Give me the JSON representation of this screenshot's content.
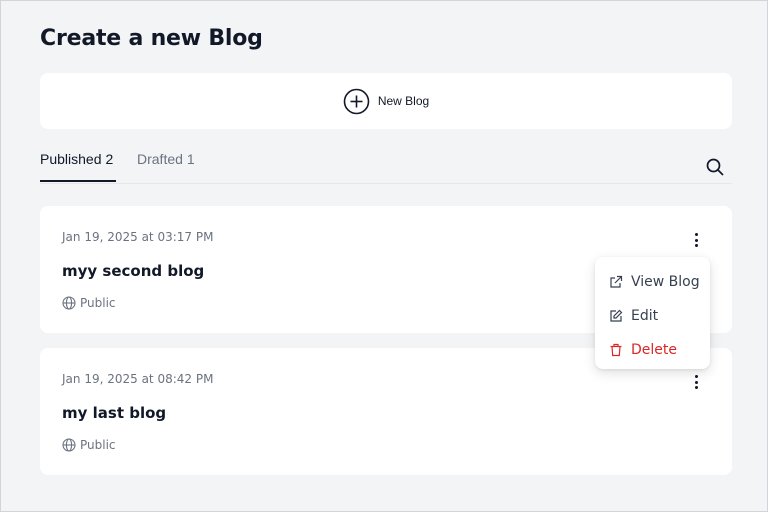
{
  "page": {
    "title": "Create a new Blog"
  },
  "new_blog": {
    "label": "New Blog"
  },
  "tabs": [
    {
      "label": "Published",
      "count": "2",
      "active": true
    },
    {
      "label": "Drafted",
      "count": "1",
      "active": false
    }
  ],
  "blogs": [
    {
      "date": "Jan 19, 2025 at 03:17 PM",
      "title": "myy second blog",
      "visibility": "Public"
    },
    {
      "date": "Jan 19, 2025 at 08:42 PM",
      "title": "my last blog",
      "visibility": "Public"
    }
  ],
  "menu": {
    "items": [
      {
        "label": "View Blog",
        "icon": "external-link-icon"
      },
      {
        "label": "Edit",
        "icon": "edit-icon"
      },
      {
        "label": "Delete",
        "icon": "trash-icon",
        "color": "#dc2626"
      }
    ]
  },
  "colors": {
    "background": "#f3f4f6",
    "card": "#ffffff",
    "danger": "#dc2626",
    "muted": "#6b7280"
  }
}
